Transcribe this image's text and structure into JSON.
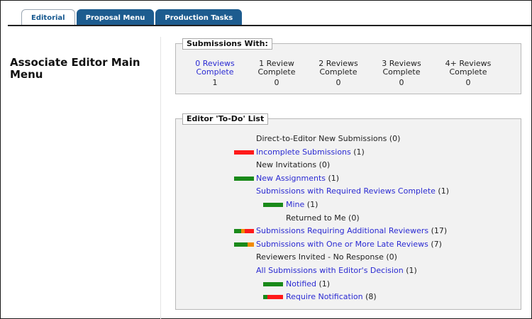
{
  "tabs": [
    {
      "label": "Editorial",
      "active": true
    },
    {
      "label": "Proposal Menu",
      "active": false
    },
    {
      "label": "Production Tasks",
      "active": false
    }
  ],
  "page_title": "Associate Editor Main Menu",
  "submissions_with": {
    "legend": "Submissions With:",
    "columns": [
      {
        "line1": "0 Reviews",
        "line2": "Complete",
        "count": "1",
        "link": true
      },
      {
        "line1": "1 Review",
        "line2": "Complete",
        "count": "0",
        "link": false
      },
      {
        "line1": "2 Reviews",
        "line2": "Complete",
        "count": "0",
        "link": false
      },
      {
        "line1": "3 Reviews",
        "line2": "Complete",
        "count": "0",
        "link": false
      },
      {
        "line1": "4+ Reviews",
        "line2": "Complete",
        "count": "0",
        "link": false
      }
    ]
  },
  "todo": {
    "legend": "Editor 'To-Do' List",
    "items": [
      {
        "label": "Direct-to-Editor New Submissions",
        "count": "(0)",
        "link": false,
        "indent": 0,
        "bar": []
      },
      {
        "label": "Incomplete Submissions",
        "count": "(1)",
        "link": true,
        "indent": 0,
        "bar": [
          "red"
        ]
      },
      {
        "label": "New Invitations",
        "count": "(0)",
        "link": false,
        "indent": 0,
        "bar": []
      },
      {
        "label": "New Assignments",
        "count": "(1)",
        "link": true,
        "indent": 0,
        "bar": [
          "green"
        ]
      },
      {
        "label": "Submissions with Required Reviews Complete",
        "count": "(1)",
        "link": true,
        "indent": 0,
        "bar": []
      },
      {
        "label": "Mine",
        "count": "(1)",
        "link": true,
        "indent": 1,
        "bar": [
          "green"
        ]
      },
      {
        "label": "Returned to Me",
        "count": "(0)",
        "link": false,
        "indent": 2,
        "bar": []
      },
      {
        "label": "Submissions Requiring Additional Reviewers",
        "count": "(17)",
        "link": true,
        "indent": 0,
        "bar": [
          "green",
          "orange",
          "red"
        ]
      },
      {
        "label": "Submissions with One or More Late Reviews",
        "count": "(7)",
        "link": true,
        "indent": 0,
        "bar": [
          "green",
          "orange"
        ]
      },
      {
        "label": "Reviewers Invited - No Response",
        "count": "(0)",
        "link": false,
        "indent": 0,
        "bar": []
      },
      {
        "label": "All Submissions with Editor's Decision",
        "count": "(1)",
        "link": true,
        "indent": 0,
        "bar": []
      },
      {
        "label": "Notified",
        "count": "(1)",
        "link": true,
        "indent": 1,
        "bar": [
          "green"
        ]
      },
      {
        "label": "Require Notification",
        "count": "(8)",
        "link": true,
        "indent": 1,
        "bar": [
          "green",
          "red"
        ]
      }
    ]
  },
  "colors": {
    "tab_blue": "#1d5c8f",
    "link": "#2a2ad2",
    "bar_green": "#1a8a1a",
    "bar_red": "#ff1a1a",
    "bar_orange": "#f08a00"
  }
}
